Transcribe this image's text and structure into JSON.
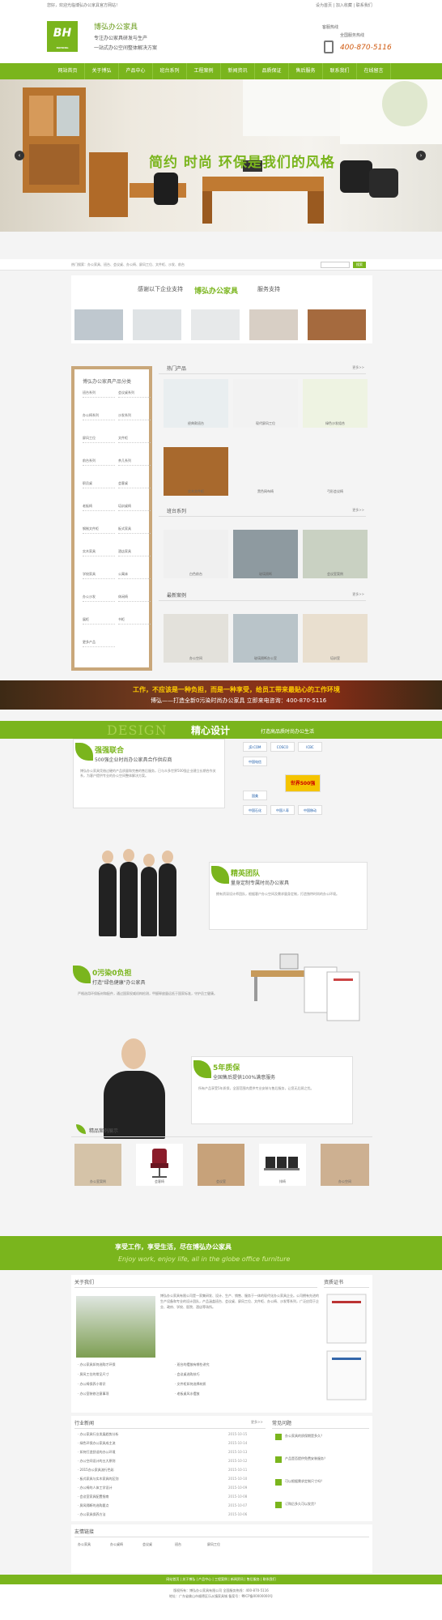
{
  "topbar": {
    "left": "您好，欢迎光临博弘办公家具官方网站！",
    "right": "设为首页 | 加入收藏 | 联系我们"
  },
  "header": {
    "logo_text": "BH",
    "logo_sub": "BOHONG",
    "brand": "博弘办公家具",
    "tagline1": "专注办公家具研发与生产",
    "tagline2": "一站式办公空间整体解决方案",
    "tel_label": "客服热线",
    "tel_label2": "全国服务热线",
    "tel_number": "400-870-5116"
  },
  "nav": [
    "网站首页",
    "关于博弘",
    "产品中心",
    "班台系列",
    "工程案例",
    "新闻资讯",
    "品质保证",
    "售后服务",
    "联系我们",
    "在线留言"
  ],
  "banner": {
    "headline": "简约 时尚 环保是我们的风格",
    "prev": "‹",
    "next": "›"
  },
  "search": {
    "hot": "热门搜索：办公家具、班台、会议桌、办公椅、屏风工位、文件柜、沙发、前台",
    "placeholder": "",
    "go": "搜索"
  },
  "cases_head": {
    "left": "感谢以下企业支持",
    "center": "博弘办公家具",
    "right": "服务支持"
  },
  "sidebar": {
    "title": "博弘办公家具产品分类",
    "items": [
      [
        "班台系列",
        "会议桌系列"
      ],
      [
        "办公椅系列",
        "沙发系列"
      ],
      [
        "屏风工位",
        "文件柜"
      ],
      [
        "前台系列",
        "茶几系列"
      ],
      [
        "职员桌",
        "会客桌"
      ],
      [
        "老板椅",
        "培训桌椅"
      ],
      [
        "钢制文件柜",
        "板式家具"
      ],
      [
        "实木家具",
        "酒店家具"
      ],
      [
        "学校家具",
        "公寓床"
      ],
      [
        "办公沙发",
        "休闲椅"
      ],
      [
        "展柜",
        "书柜"
      ],
      [
        "更多产品",
        ""
      ]
    ]
  },
  "sections": [
    {
      "title": "热门产品",
      "more": "更多>>"
    },
    {
      "title": "班台系列",
      "more": "更多>>"
    },
    {
      "title": "最新案例",
      "more": "更多>>"
    }
  ],
  "products": [
    [
      "经典款班台",
      "现代屏风工位",
      "绿色沙发组合"
    ],
    [
      "实木文件柜",
      "黑色网布椅",
      "弓形会议椅"
    ],
    [
      "白色前台",
      "玻璃隔断",
      "会议室案例"
    ],
    [
      "办公空间",
      "玻璃隔断办公室",
      "培训室"
    ]
  ],
  "promo": {
    "line1": "工作，不应该是一种负担，而是一种享受，给员工带来最贴心的工作环境",
    "line2": "博弘——打造全新0污染时尚办公家具   立即来电咨询：400-870-5116"
  },
  "design_band": {
    "english": "DESIGN",
    "bold": "精心设计",
    "sub": "打造高品质时尚办公生活"
  },
  "features": [
    {
      "head": "强强联合",
      "sub": "500强企业时尚办公家具合作供应商",
      "body": "博弘办公家具凭借过硬的产品质量和完善的售后服务，已与众多世界500强企业建立长期合作关系，为客户提供专业的办公空间整体解决方案。"
    },
    {
      "head": "精英团队",
      "sub": "量身定制专属时尚办公家具",
      "body": "拥有资深设计师团队，根据客户办公空间及需求量身定制，打造独特时尚的办公环境。"
    },
    {
      "head": "0污染0负担",
      "sub": "打造\"绿色健康\"办公家具",
      "body": "严格选用环保板材和配件，通过国家权威机构检测，甲醛释放量远低于国家标准，守护员工健康。"
    },
    {
      "head": "5年质保",
      "sub": "全国售后提供100%满意服务",
      "body": "所有产品享受5年质保，全国范围内提供专业安装与售后服务，让您无后顾之忧。"
    }
  ],
  "partners": [
    "JD.COM",
    "COSCO",
    "ICBC",
    "中国电信",
    "世界500强",
    "国美",
    "中国石化",
    "中国人寿",
    "中国移动"
  ],
  "cases2": {
    "title": "精品案例展示",
    "items": [
      "办公室案例",
      "会客椅",
      "会议室",
      "排椅",
      "办公空间"
    ]
  },
  "slogan": {
    "zh": "享受工作，享受生活，尽在博弘办公家具",
    "en": "Enjoy work, enjoy life, all in the globe office furniture"
  },
  "about": {
    "title": "关于我们",
    "cert_title": "资质证书",
    "body": "博弘办公家具有限公司是一家集研发、设计、生产、销售、服务于一体的现代化办公家具企业。公司拥有先进的生产设备和专业的设计团队，产品涵盖班台、会议桌、屏风工位、文件柜、办公椅、沙发等系列，广泛应用于企业、政府、学校、医院、酒店等场所。",
    "links": [
      "办公家具如何选购才环保",
      "班台的摆放有哪些讲究",
      "屏风工位的常见尺寸",
      "会议桌选购技巧",
      "办公椅保养小常识",
      "文件柜如何选择材质",
      "办公室装修注意事项",
      "老板桌风水摆放"
    ]
  },
  "news": {
    "title": "行业新闻",
    "more": "更多>>",
    "faq_title": "常见问题",
    "items": [
      [
        "办公家具行业发展趋势分析",
        "2015-10-15"
      ],
      [
        "绿色环保办公家具成主流",
        "2015-10-14"
      ],
      [
        "如何打造舒适的办公环境",
        "2015-10-13"
      ],
      [
        "办公空间设计的五大原则",
        "2015-10-12"
      ],
      [
        "2015办公家具流行色彩",
        "2015-10-11"
      ],
      [
        "板式家具与实木家具的区别",
        "2015-10-10"
      ],
      [
        "办公椅的人体工学设计",
        "2015-10-09"
      ],
      [
        "会议室家具配置指南",
        "2015-10-08"
      ],
      [
        "屏风隔断的选购要点",
        "2015-10-07"
      ],
      [
        "办公家具保养方法",
        "2015-10-06"
      ]
    ],
    "faq": [
      "办公家具的质保期是多久？",
      "产品是否提供免费安装服务？",
      "可以根据需求定制尺寸吗？",
      "订购后多久可以发货？"
    ]
  },
  "friend_links": {
    "title": "友情链接",
    "items": [
      "办公家具",
      "办公桌椅",
      "会议桌",
      "班台",
      "屏风工位"
    ]
  },
  "footer": {
    "nav": "网站首页 | 关于博弘 | 产品中心 | 工程案例 | 新闻资讯 | 售后服务 | 联系我们",
    "line1": "版权所有：博弘办公家具有限公司   全国服务热线：400-870-5116",
    "line2": "地址：广东省佛山市顺德区乐从镇家具城   备案号：粤ICP备00000000号"
  }
}
